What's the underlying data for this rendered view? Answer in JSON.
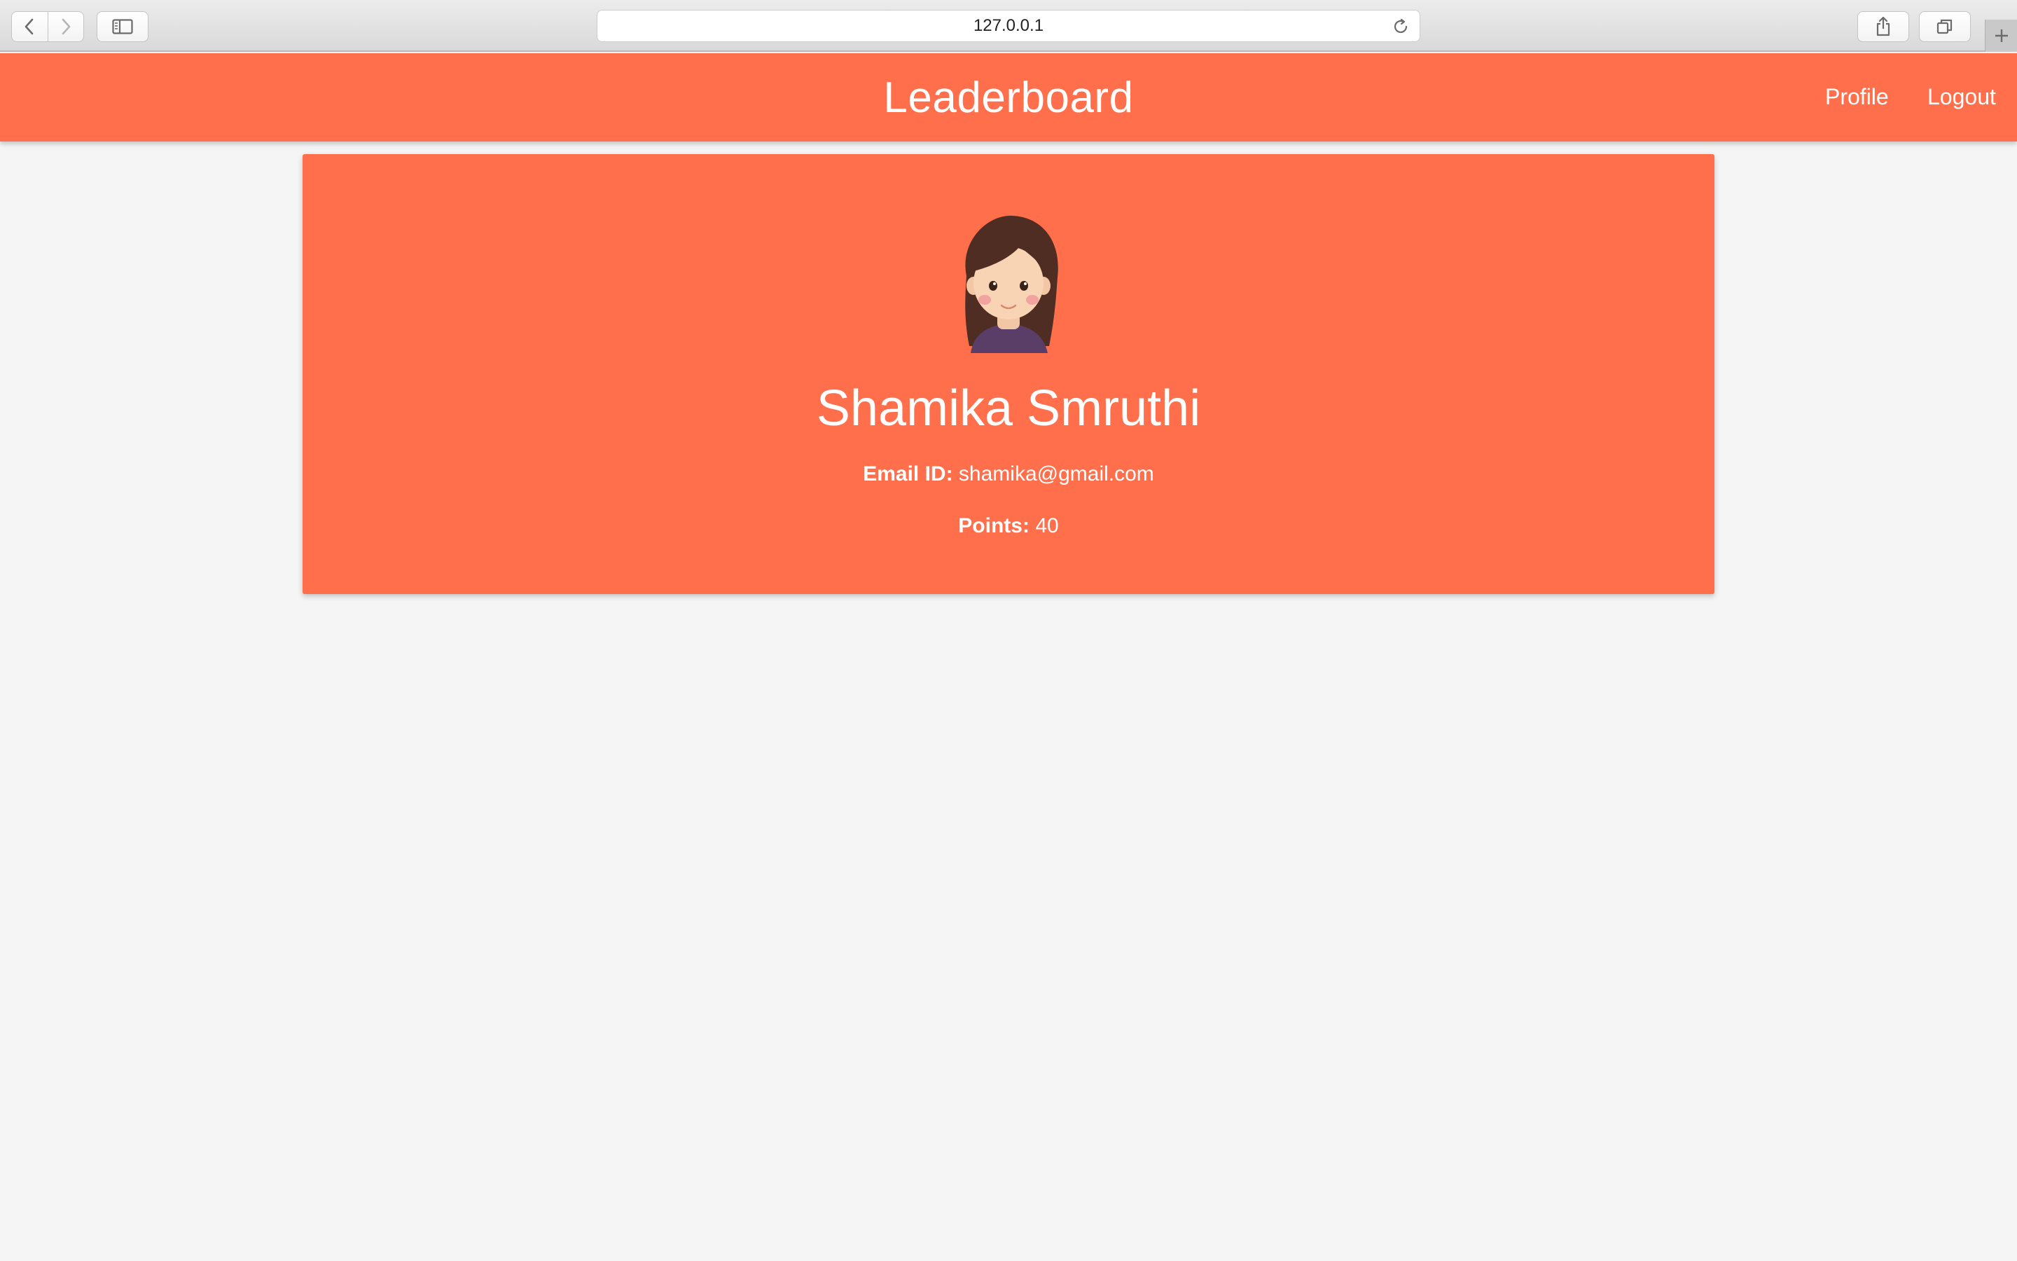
{
  "browser": {
    "url": "127.0.0.1",
    "icons": [
      "back-icon",
      "forward-icon",
      "sidebar-icon",
      "reload-icon",
      "share-icon",
      "tabs-icon",
      "plus-icon"
    ]
  },
  "header": {
    "title": "Leaderboard",
    "nav": {
      "profile": "Profile",
      "logout": "Logout"
    },
    "background_color": "#ff6f4b"
  },
  "profile": {
    "name": "Shamika Smruthi",
    "email_label": "Email ID:",
    "email": "shamika@gmail.com",
    "points_label": "Points:",
    "points": "40",
    "avatar_icon": "girl-avatar-icon"
  },
  "colors": {
    "accent": "#ff6f4b",
    "page_background": "#f5f5f5",
    "text_on_accent": "#ffffff"
  }
}
